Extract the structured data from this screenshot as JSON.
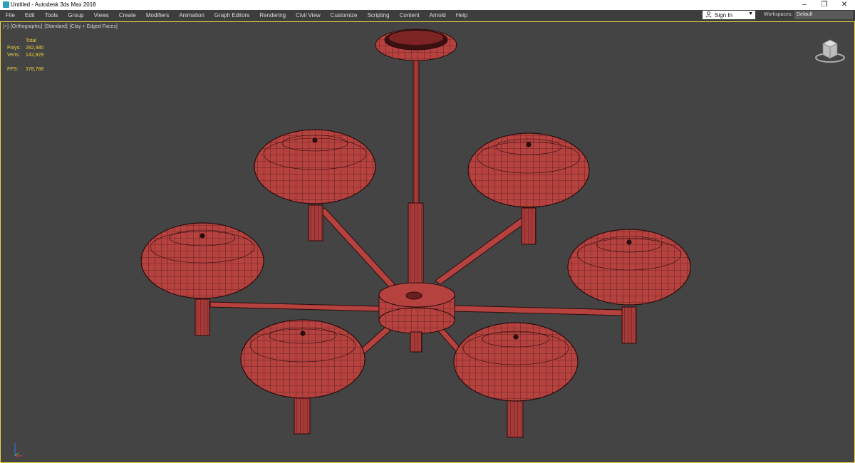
{
  "window": {
    "title": "Untitled - Autodesk 3ds Max 2018",
    "minimize": "–",
    "restore": "❐",
    "close": "✕"
  },
  "menu": [
    "File",
    "Edit",
    "Tools",
    "Group",
    "Views",
    "Create",
    "Modifiers",
    "Animation",
    "Graph Editors",
    "Rendering",
    "Civil View",
    "Customize",
    "Scripting",
    "Content",
    "Arnold",
    "Help"
  ],
  "account": {
    "signin_label": "Sign In",
    "caret": "▼"
  },
  "workspaces": {
    "label": "Workspaces:",
    "value": "Default"
  },
  "viewport": {
    "labels": [
      "[+]",
      "[Orthographic]",
      "[Standard]",
      "[Clay + Edged Faces]"
    ],
    "stats": {
      "header": "Total",
      "polys_label": "Polys:",
      "polys_value": "282,480",
      "verts_label": "Verts:",
      "verts_value": "142,929",
      "fps_label": "FPS:",
      "fps_value": "378,788"
    }
  },
  "colors": {
    "viewport_bg": "#444444",
    "active_border": "#e7d64a",
    "stats_text": "#e8d23a",
    "clay": "#b5423f",
    "wire": "#2a0d0d"
  },
  "icons": {
    "app": "3ds-max-icon",
    "user": "user-icon",
    "viewcube": "viewcube-icon",
    "axis": "axis-tripod-icon"
  }
}
